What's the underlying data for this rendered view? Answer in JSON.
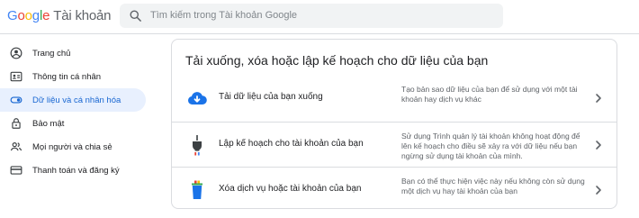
{
  "header": {
    "logo": {
      "letters": [
        "G",
        "o",
        "o",
        "g",
        "l",
        "e"
      ],
      "product": "Tài khoản"
    },
    "search_placeholder": "Tìm kiếm trong Tài khoản Google"
  },
  "sidebar": {
    "items": [
      {
        "label": "Trang chủ",
        "icon": "home-icon",
        "active": false
      },
      {
        "label": "Thông tin cá nhân",
        "icon": "id-card-icon",
        "active": false
      },
      {
        "label": "Dữ liệu và cá nhân hóa",
        "icon": "toggle-icon",
        "active": true
      },
      {
        "label": "Bảo mật",
        "icon": "lock-icon",
        "active": false
      },
      {
        "label": "Mọi người và chia sẻ",
        "icon": "people-icon",
        "active": false
      },
      {
        "label": "Thanh toán và đăng ký",
        "icon": "credit-card-icon",
        "active": false
      }
    ]
  },
  "card": {
    "title": "Tải xuống, xóa hoặc lập kế hoạch cho dữ liệu của bạn",
    "rows": [
      {
        "label": "Tải dữ liệu của bạn xuống",
        "description": "Tạo bản sao dữ liệu của bạn để sử dụng với một tài khoản hay dịch vụ khác",
        "icon": "cloud-download-icon"
      },
      {
        "label": "Lập kế hoạch cho tài khoản của bạn",
        "description": "Sử dụng Trình quản lý tài khoản không hoạt động để lên kế hoạch cho điều sẽ xảy ra với dữ liệu nếu bạn ngừng sử dụng tài khoản của mình.",
        "icon": "plug-icon"
      },
      {
        "label": "Xóa dịch vụ hoặc tài khoản của bạn",
        "description": "Bạn có thể thực hiện việc này nếu không còn sử dụng một dịch vụ hay tài khoản của bạn",
        "icon": "trash-can-icon"
      }
    ]
  },
  "colors": {
    "accent": "#1a73e8",
    "active_nav_bg": "#e8f0fe",
    "active_nav_text": "#1967d2",
    "divider": "#dadce0"
  }
}
